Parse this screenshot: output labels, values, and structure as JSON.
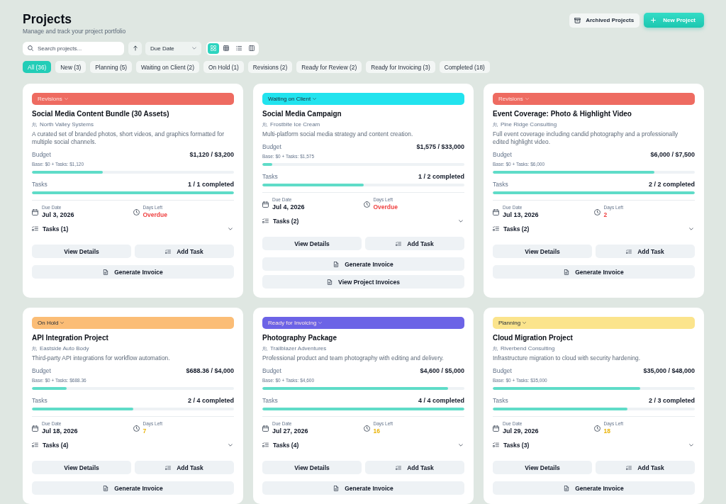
{
  "header": {
    "title": "Projects",
    "subtitle": "Manage and track your project portfolio",
    "actions": [
      {
        "label": "Archived Projects",
        "kind": "archive"
      },
      {
        "label": "New Project",
        "kind": "create"
      }
    ]
  },
  "toolbar": {
    "search": {
      "placeholder": "Search projects..."
    },
    "sort": {
      "descending": false,
      "field": "Due Date"
    },
    "views": [
      {
        "kind": "cards",
        "selected": true
      },
      {
        "kind": "table",
        "selected": false
      },
      {
        "kind": "list",
        "selected": false
      },
      {
        "kind": "columns",
        "selected": false
      }
    ]
  },
  "filters": [
    {
      "label": "All (36)",
      "selected": true
    },
    {
      "label": "New (3)",
      "selected": false
    },
    {
      "label": "Planning (5)",
      "selected": false
    },
    {
      "label": "Waiting on Client (2)",
      "selected": false
    },
    {
      "label": "On Hold (1)",
      "selected": false
    },
    {
      "label": "Revisions (2)",
      "selected": false
    },
    {
      "label": "Ready for Review (2)",
      "selected": false
    },
    {
      "label": "Ready for Invoicing (3)",
      "selected": false
    },
    {
      "label": "Completed (18)",
      "selected": false
    }
  ],
  "projects": [
    {
      "status": {
        "label": "Revisions",
        "color": "#ee6b61"
      },
      "title": "Social Media Content Bundle (30 Assets)",
      "client": "North Valley Systems",
      "description": "A curated set of branded photos, short videos, and graphics formatted for multiple social channels.",
      "budget": {
        "label": "Budget",
        "amount": "$1,120 / $3,200",
        "breakdown": "Base: $0 + Tasks: $1,120",
        "level": 0.35
      },
      "tasks": {
        "label": "Tasks",
        "summary": "1 / 1 completed",
        "level": 1
      },
      "due": {
        "label": "Due Date",
        "value": "Jul 3, 2026"
      },
      "days_left": {
        "label": "Days Left",
        "value": "Overdue",
        "urgent": true
      },
      "task_list": {
        "label": "Tasks (1)",
        "expanded": false
      },
      "actions": [
        {
          "label": "View Details",
          "kind": "details"
        },
        {
          "label": "Add Task",
          "kind": "add-task"
        },
        {
          "label": "Generate Invoice",
          "kind": "invoice"
        }
      ]
    },
    {
      "status": {
        "label": "Waiting on Client",
        "color": "#22e3ee"
      },
      "title": "Social Media Campaign",
      "client": "Frostbite Ice Cream",
      "description": "Multi-platform social media strategy and content creation.",
      "budget": {
        "label": "Budget",
        "amount": "$1,575 / $33,000",
        "breakdown": "Base: $0 + Tasks: $1,575",
        "level": 0.048
      },
      "tasks": {
        "label": "Tasks",
        "summary": "1 / 2 completed",
        "level": 0.5
      },
      "due": {
        "label": "Due Date",
        "value": "Jul 4, 2026"
      },
      "days_left": {
        "label": "Days Left",
        "value": "Overdue",
        "urgent": true
      },
      "task_list": {
        "label": "Tasks (2)",
        "expanded": false
      },
      "actions": [
        {
          "label": "View Details",
          "kind": "details"
        },
        {
          "label": "Add Task",
          "kind": "add-task"
        },
        {
          "label": "Generate Invoice",
          "kind": "invoice"
        },
        {
          "label": "View Project Invoices",
          "kind": "invoices"
        }
      ]
    },
    {
      "status": {
        "label": "Revisions",
        "color": "#ee6b61"
      },
      "title": "Event Coverage: Photo & Highlight Video",
      "client": "Pine Ridge Consulting",
      "description": "Full event coverage including candid photography and a professionally edited highlight video.",
      "budget": {
        "label": "Budget",
        "amount": "$6,000 / $7,500",
        "breakdown": "Base: $0 + Tasks: $6,000",
        "level": 0.8
      },
      "tasks": {
        "label": "Tasks",
        "summary": "2 / 2 completed",
        "level": 1
      },
      "due": {
        "label": "Due Date",
        "value": "Jul 13, 2026"
      },
      "days_left": {
        "label": "Days Left",
        "value": "2",
        "urgent": true
      },
      "task_list": {
        "label": "Tasks (2)",
        "expanded": false
      },
      "actions": [
        {
          "label": "View Details",
          "kind": "details"
        },
        {
          "label": "Add Task",
          "kind": "add-task"
        },
        {
          "label": "Generate Invoice",
          "kind": "invoice"
        }
      ]
    },
    {
      "status": {
        "label": "On Hold",
        "color": "#fbbd76"
      },
      "title": "API Integration Project",
      "client": "Eastside Auto Body",
      "description": "Third-party API integrations for workflow automation.",
      "budget": {
        "label": "Budget",
        "amount": "$688.36 / $4,000",
        "breakdown": "Base: $0 + Tasks: $688.36",
        "level": 0.172
      },
      "tasks": {
        "label": "Tasks",
        "summary": "2 / 4 completed",
        "level": 0.5
      },
      "due": {
        "label": "Due Date",
        "value": "Jul 18, 2026"
      },
      "days_left": {
        "label": "Days Left",
        "value": "7",
        "urgent": false
      },
      "task_list": {
        "label": "Tasks (4)",
        "expanded": false
      },
      "actions": [
        {
          "label": "View Details",
          "kind": "details"
        },
        {
          "label": "Add Task",
          "kind": "add-task"
        },
        {
          "label": "Generate Invoice",
          "kind": "invoice"
        }
      ]
    },
    {
      "status": {
        "label": "Ready for Invoicing",
        "color": "#6c63e6"
      },
      "title": "Photography Package",
      "client": "Trailblazer Adventures",
      "description": "Professional product and team photography with editing and delivery.",
      "budget": {
        "label": "Budget",
        "amount": "$4,600 / $5,000",
        "breakdown": "Base: $0 + Tasks: $4,600",
        "level": 0.92
      },
      "tasks": {
        "label": "Tasks",
        "summary": "4 / 4 completed",
        "level": 1
      },
      "due": {
        "label": "Due Date",
        "value": "Jul 27, 2026"
      },
      "days_left": {
        "label": "Days Left",
        "value": "16",
        "urgent": false
      },
      "task_list": {
        "label": "Tasks (4)",
        "expanded": false
      },
      "actions": [
        {
          "label": "View Details",
          "kind": "details"
        },
        {
          "label": "Add Task",
          "kind": "add-task"
        },
        {
          "label": "Generate Invoice",
          "kind": "invoice"
        }
      ]
    },
    {
      "status": {
        "label": "Planning",
        "color": "#fbe48c"
      },
      "title": "Cloud Migration Project",
      "client": "Riverbend Consulting",
      "description": "Infrastructure migration to cloud with security hardening.",
      "budget": {
        "label": "Budget",
        "amount": "$35,000 / $48,000",
        "breakdown": "Base: $0 + Tasks: $35,000",
        "level": 0.729
      },
      "tasks": {
        "label": "Tasks",
        "summary": "2 / 3 completed",
        "level": 0.667
      },
      "due": {
        "label": "Due Date",
        "value": "Jul 29, 2026"
      },
      "days_left": {
        "label": "Days Left",
        "value": "18",
        "urgent": false
      },
      "task_list": {
        "label": "Tasks (3)",
        "expanded": false
      },
      "actions": [
        {
          "label": "View Details",
          "kind": "details"
        },
        {
          "label": "Add Task",
          "kind": "add-task"
        },
        {
          "label": "Generate Invoice",
          "kind": "invoice"
        }
      ]
    }
  ]
}
